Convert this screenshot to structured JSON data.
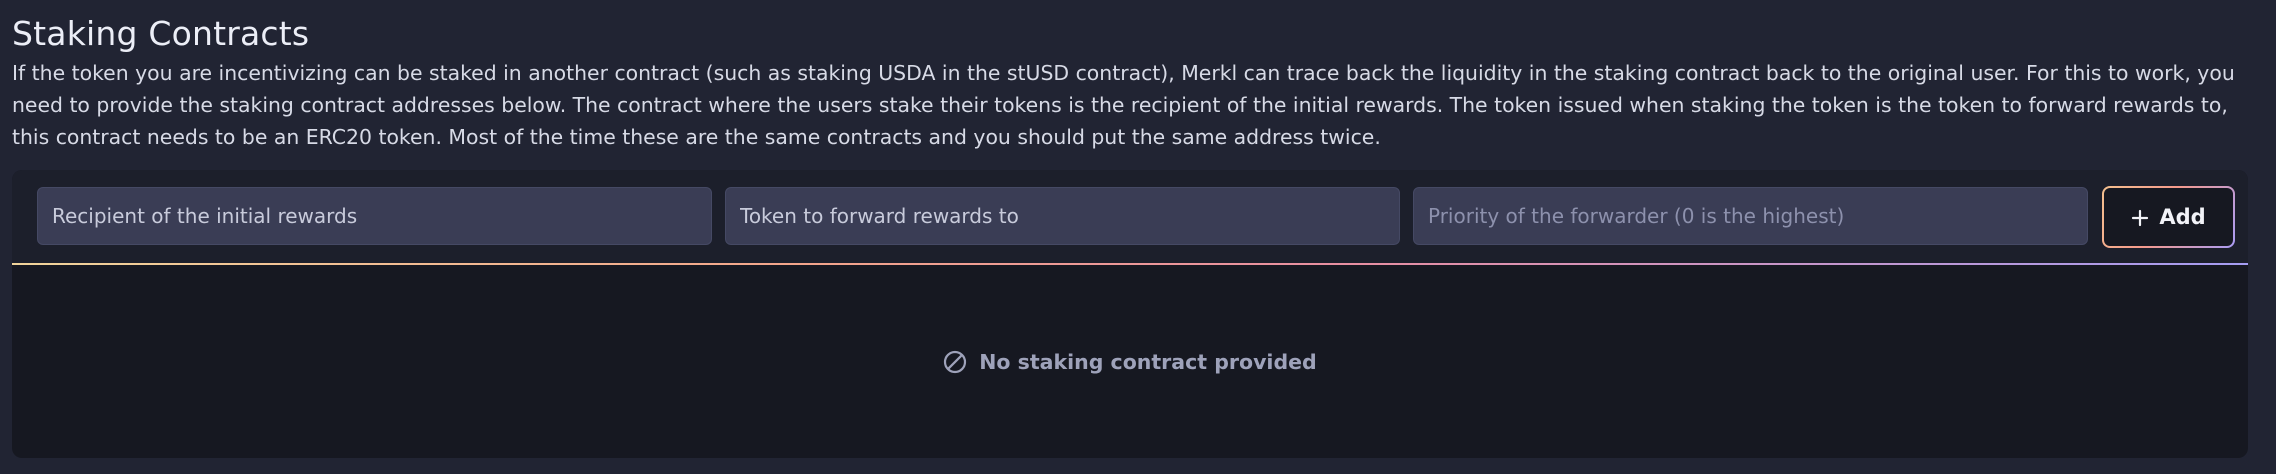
{
  "section": {
    "title": "Staking Contracts",
    "description": "If the token you are incentivizing can be staked in another contract (such as staking USDA in the stUSD contract), Merkl can trace back the liquidity in the staking contract back to the original user. For this to work, you need to provide the staking contract addresses below. The contract where the users stake their tokens is the recipient of the initial rewards. The token issued when staking the token is the token to forward rewards to, this contract needs to be an ERC20 token. Most of the time these are the same contracts and you should put the same address twice."
  },
  "form": {
    "recipient_placeholder": "Recipient of the initial rewards",
    "token_placeholder": "Token to forward rewards to",
    "priority_placeholder": "Priority of the forwarder (0 is the highest)",
    "add_label": "Add",
    "add_icon": "plus-icon"
  },
  "empty_state": {
    "icon": "ban-icon",
    "message": "No staking contract provided"
  },
  "colors": {
    "background": "#212433",
    "card": "#161821",
    "input": "#3a3d55",
    "gradient_start": "#f1d49b",
    "gradient_mid": "#f3a58b",
    "gradient_end": "#a59df3",
    "muted_text": "#9ea2ba"
  }
}
